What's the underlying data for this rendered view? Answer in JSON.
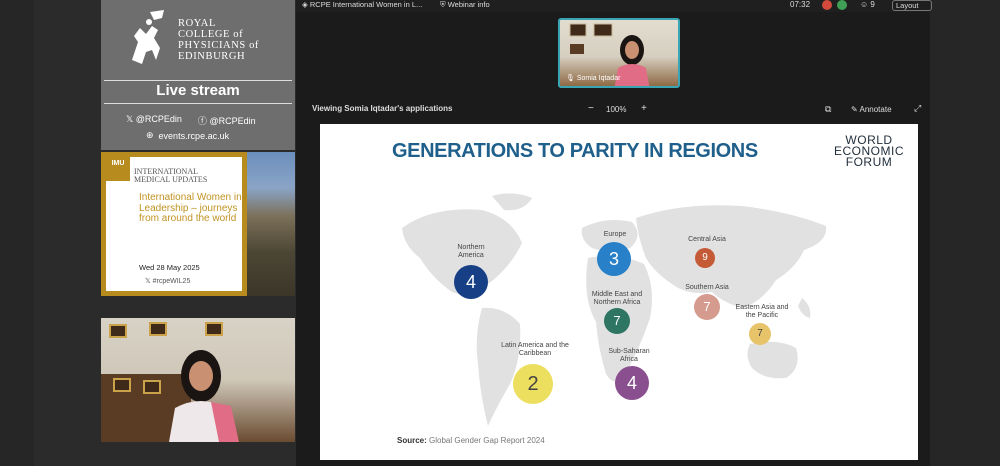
{
  "stream_panel": {
    "org_lines": [
      "ROYAL",
      "COLLEGE of",
      "PHYSICIANS of",
      "EDINBURGH"
    ],
    "live_stream_label": "Live stream",
    "twitter_handle": "@RCPEdin",
    "facebook_handle": "@RCPEdin",
    "website": "events.rcpe.ac.uk",
    "event_card": {
      "badge": "IMU",
      "series_lines": [
        "INTERNATIONAL",
        "MEDICAL UPDATES"
      ],
      "title": "International Women in Leadership – journeys from around the world",
      "date": "Wed 28 May 2025",
      "hashtag": "#rcpeWIL25"
    }
  },
  "top_bar": {
    "tab_meeting": "RCPE International Women in L...",
    "tab_webinar": "Webinar info",
    "time": "07:32",
    "participants": "9",
    "layout_label": "Layout"
  },
  "presenter": {
    "name": "Somia Iqtadar"
  },
  "share_bar": {
    "viewing_text": "Viewing Somia Iqtadar's applications",
    "zoom_minus": "−",
    "zoom_level": "100%",
    "zoom_plus": "+",
    "annotate_label": "Annotate"
  },
  "slide": {
    "title": "GENERATIONS TO PARITY IN REGIONS",
    "logo_lines": [
      "WORLD",
      "ECONOMIC",
      "FORUM"
    ],
    "source_label": "Source:",
    "source_text": "Global Gender Gap Report 2024",
    "regions": [
      {
        "name": "Northern America",
        "value": "4",
        "color": "#163f86"
      },
      {
        "name": "Europe",
        "value": "3",
        "color": "#2780c8"
      },
      {
        "name": "Central Asia",
        "value": "9",
        "color": "#c55a36"
      },
      {
        "name": "Middle East and Northern Africa",
        "value": "7",
        "color": "#2f7563"
      },
      {
        "name": "Southern Asia",
        "value": "7",
        "color": "#d59b8e"
      },
      {
        "name": "Eastern Asia and the Pacific",
        "value": "7",
        "color": "#e7c46a"
      },
      {
        "name": "Latin America and the Caribbean",
        "value": "2",
        "color": "#ecdf5f"
      },
      {
        "name": "Sub-Saharan Africa",
        "value": "4",
        "color": "#8a4f8f"
      }
    ]
  },
  "colors": {
    "accent_gold": "#b78b1e",
    "title_blue": "#1f5f8b",
    "thumb_border": "#3aa5b5"
  },
  "icons": [
    "twitter-x-icon",
    "facebook-icon",
    "globe-icon",
    "windows-tab-icon",
    "shield-tab-icon",
    "mic-icon",
    "share-view-icon",
    "annotate-icon",
    "expand-icon",
    "people-icon"
  ]
}
